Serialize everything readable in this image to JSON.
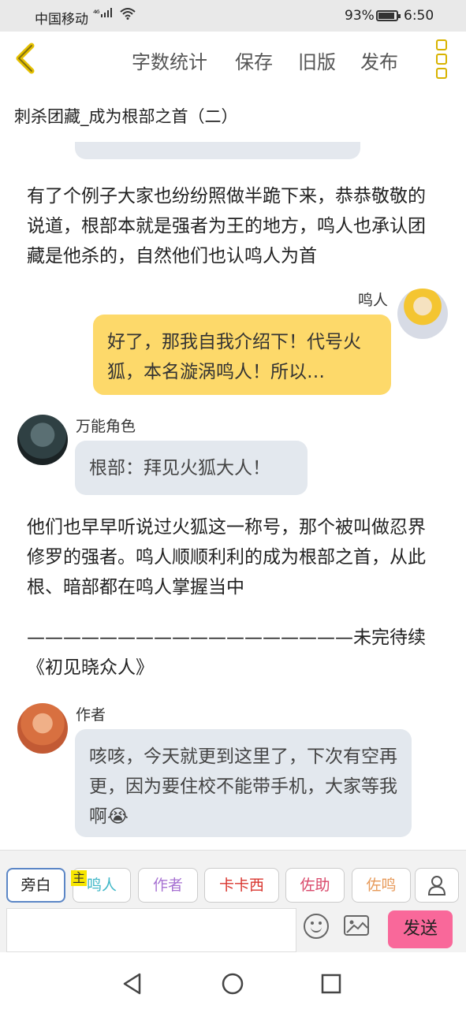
{
  "status_bar": {
    "carrier": "中国移动",
    "network": "⁴⁶",
    "battery": "93%",
    "time": "6:50"
  },
  "toolbar": {
    "word_count": "字数统计",
    "save": "保存",
    "old_version": "旧版",
    "publish": "发布"
  },
  "title": "刺杀团藏_成为根部之首（二）",
  "content": {
    "narration_1": "有了个例子大家也纷纷照做半跪下来，恭恭敬敬的说道，根部本就是强者为王的地方，鸣人也承认团藏是他杀的，自然他们也认鸣人为首",
    "msg_naruto": {
      "name": "鸣人",
      "text": "好了，那我自我介绍下！代号火狐，本名漩涡鸣人！所以…"
    },
    "msg_universal": {
      "name": "万能角色",
      "text": "根部：拜见火狐大人！"
    },
    "narration_2": "他们也早早听说过火狐这一称号，那个被叫做忍界修罗的强者。鸣人顺顺利利的成为根部之首，从此根、暗部都在鸣人掌握当中",
    "narration_3": "——————————————————未完待续《初见晓众人》",
    "msg_author": {
      "name": "作者",
      "text": "咳咳，今天就更到这里了，下次有空再更，因为要住校不能带手机，大家等我啊😭"
    }
  },
  "roles": {
    "badge": "主",
    "items": [
      {
        "label": "旁白",
        "color": "#666666"
      },
      {
        "label": "鸣人",
        "color": "#3fb7c7"
      },
      {
        "label": "作者",
        "color": "#a772d2"
      },
      {
        "label": "卡卡西",
        "color": "#d9362f"
      },
      {
        "label": "佐助",
        "color": "#d9486a"
      },
      {
        "label": "佐鸣",
        "color": "#e79a5a"
      }
    ]
  },
  "composer": {
    "send": "发送"
  }
}
